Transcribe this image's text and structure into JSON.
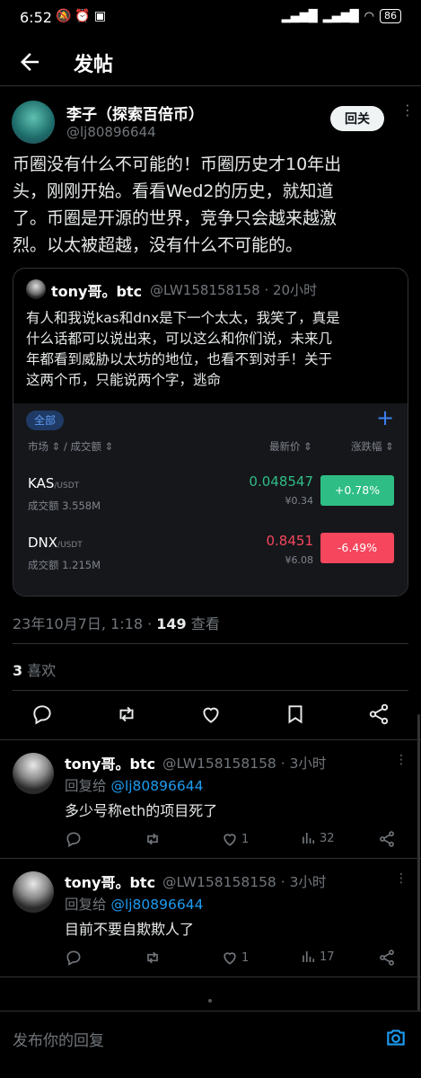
{
  "status_bar": {
    "time": "6:52",
    "battery": "86"
  },
  "header": {
    "title": "发帖"
  },
  "main_tweet": {
    "name": "李子（探索百倍币）",
    "handle": "@lj80896644",
    "follow_label": "回关",
    "lines": [
      "币圈没有什么不可能的！币圈历史才10年出",
      "头，刚刚开始。看看Wed2的历史，就知道",
      "了。币圈是开源的世界，竞争只会越来越激",
      "烈。以太被超越，没有什么不可能的。"
    ],
    "timestamp": "23年10月7日, 1:18 · ",
    "views_count": "149",
    "views_label": " 查看",
    "likes_count": "3",
    "likes_label": " 喜欢"
  },
  "quote": {
    "name": "tony哥。btc",
    "meta": "@LW158158158 · 20小时",
    "lines": [
      "有人和我说kas和dnx是下一个太太，我笑了，真是",
      "什么话都可以说出来，可以这么和你们说，未来几",
      "年都看到威胁以太坊的地位，也看不到对手！关于",
      "这两个币，只能说两个字，逃命"
    ],
    "market": {
      "tab_all": "全部",
      "header_market": "市场 ⇕ / 成交额 ⇕",
      "header_price": "最新价 ⇕",
      "header_change": "涨跌幅 ⇕",
      "rows": [
        {
          "coin": "KAS",
          "pair": "/USDT",
          "volume": "成交额 3.558M",
          "price": "0.048547",
          "cny": "¥0.34",
          "change": "+0.78%",
          "dir": "up"
        },
        {
          "coin": "DNX",
          "pair": "/USDT",
          "volume": "成交额 1.215M",
          "price": "0.8451",
          "cny": "¥6.08",
          "change": "-6.49%",
          "dir": "down"
        }
      ]
    }
  },
  "replies": [
    {
      "name": "tony哥。btc",
      "meta": "@LW158158158 · 3小时",
      "reply_prefix": "回复给 ",
      "reply_to": "@lj80896644",
      "text": "多少号称eth的项目死了",
      "likes": "1",
      "views": "32"
    },
    {
      "name": "tony哥。btc",
      "meta": "@LW158158158 · 3小时",
      "reply_prefix": "回复给 ",
      "reply_to": "@lj80896644",
      "text": "目前不要自欺欺人了",
      "likes": "1",
      "views": "17"
    }
  ],
  "compose": {
    "placeholder": "发布你的回复"
  }
}
